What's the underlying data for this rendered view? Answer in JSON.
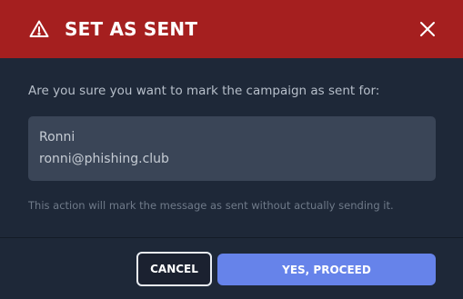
{
  "dialog": {
    "title": "SET AS SENT",
    "warning_icon": "warning-triangle-icon",
    "close_icon": "close-icon"
  },
  "body": {
    "question": "Are you sure you want to mark the campaign as sent for:",
    "recipient": {
      "name": "Ronni",
      "email": "ronni@phishing.club"
    },
    "note": "This action will mark the message as sent without actually sending it."
  },
  "actions": {
    "cancel_label": "CANCEL",
    "proceed_label": "YES, PROCEED"
  },
  "colors": {
    "header_bg": "#a51f1f",
    "body_bg": "#1e2838",
    "box_bg": "#3a4557",
    "primary": "#6683ea"
  }
}
